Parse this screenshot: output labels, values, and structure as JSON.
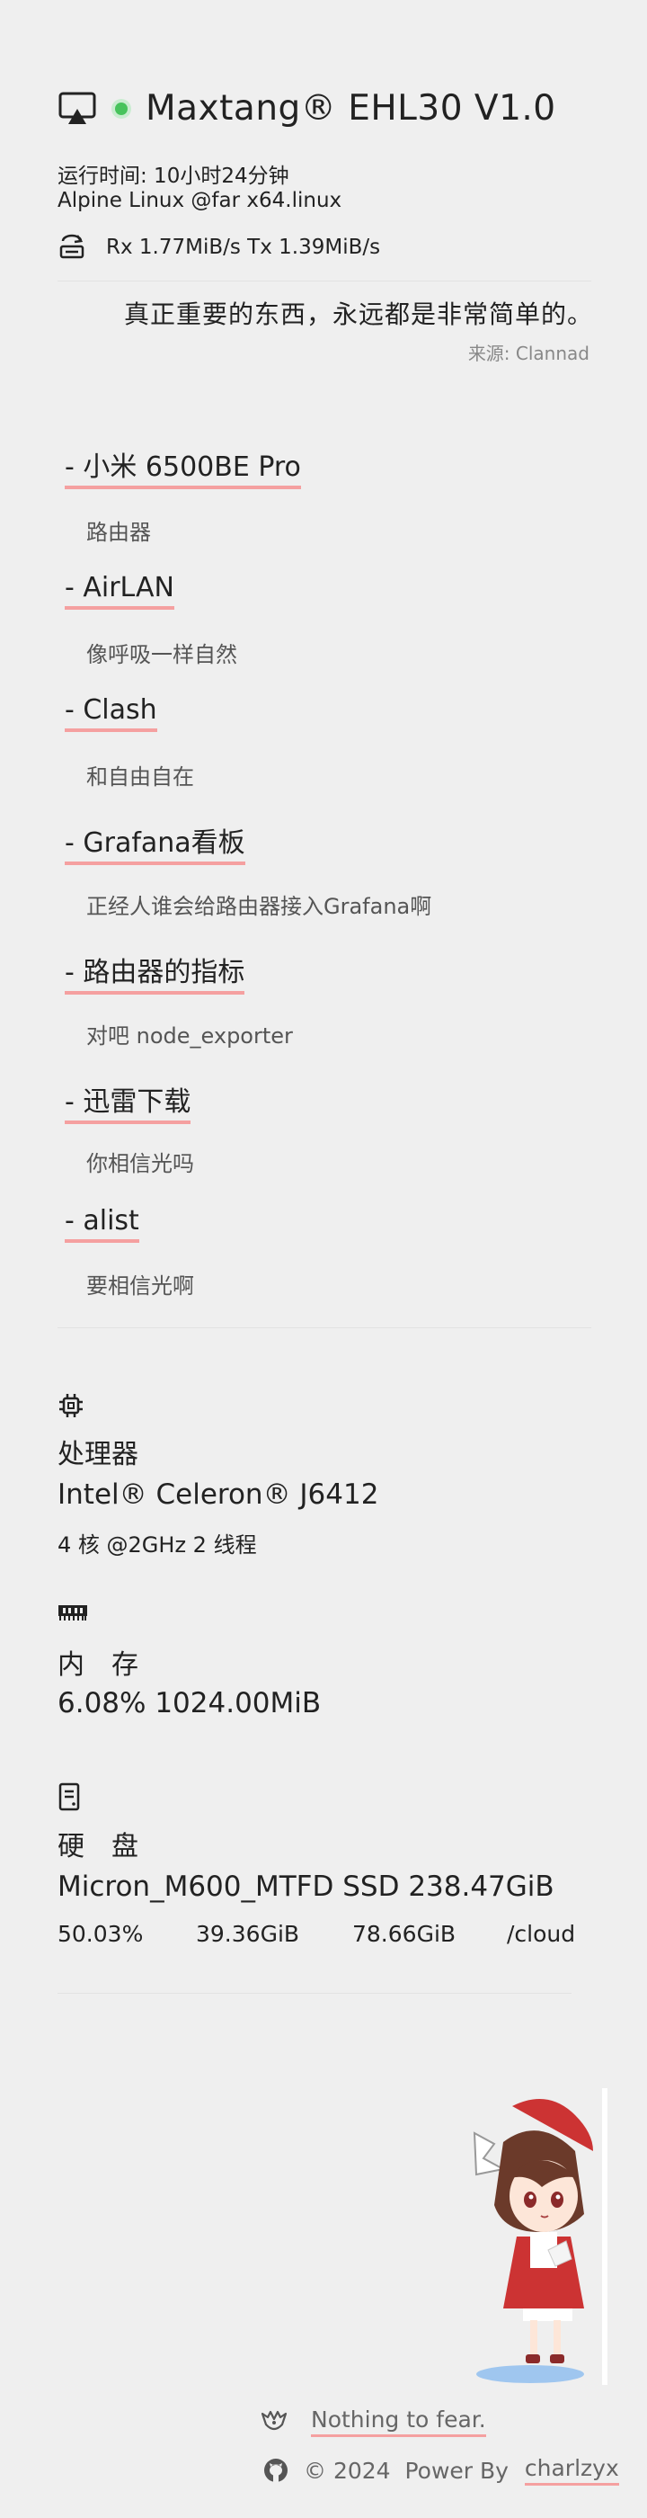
{
  "header": {
    "title": "Maxtang® EHL30 V1.0",
    "uptime": "运行时间: 10小时24分钟",
    "os": "Alpine Linux @far x64.linux",
    "network": "Rx 1.77MiB/s Tx 1.39MiB/s"
  },
  "quote": {
    "text": "真正重要的东西，永远都是非常简单的。",
    "source": "来源: Clannad"
  },
  "links": [
    {
      "label": "- 小米 6500BE Pro",
      "desc": "路由器"
    },
    {
      "label": "- AirLAN",
      "desc": "像呼吸一样自然"
    },
    {
      "label": "- Clash",
      "desc": "和自由自在"
    },
    {
      "label": "- Grafana看板",
      "desc": "正经人谁会给路由器接入Grafana啊"
    },
    {
      "label": "- 路由器的指标",
      "desc": "对吧 node_exporter"
    },
    {
      "label": "- 迅雷下载",
      "desc": "你相信光吗"
    },
    {
      "label": "- alist",
      "desc": "要相信光啊"
    }
  ],
  "cpu": {
    "label": "处理器",
    "model": "Intel® Celeron® J6412",
    "detail": "4 核 @2GHz 2 线程"
  },
  "memory": {
    "label": "内　存",
    "value": "6.08% 1024.00MiB"
  },
  "disk": {
    "label": "硬　盘",
    "model": "Micron_M600_MTFD SSD 238.47GiB",
    "usage": [
      "50.03%",
      "39.36GiB",
      "78.66GiB",
      "/cloud"
    ]
  },
  "footer": {
    "slogan": "Nothing to fear.",
    "copyright": "© 2024  Power By ",
    "author": "charlzyx"
  },
  "colors": {
    "status": "#47c35c",
    "underline": "#f5a0a0"
  },
  "icons": [
    "airplay-icon",
    "status-dot",
    "network-icon",
    "cpu-icon",
    "memory-icon",
    "disk-icon",
    "bug-icon",
    "github-icon"
  ]
}
